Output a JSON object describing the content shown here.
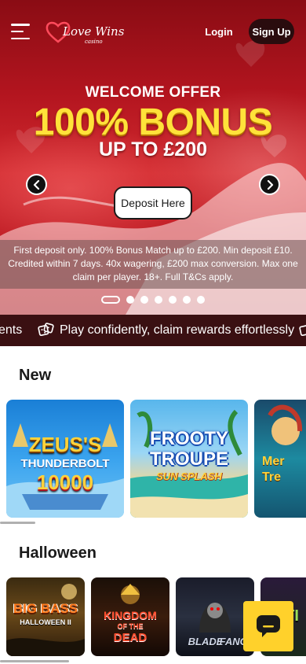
{
  "header": {
    "logo_text": "Love Wins",
    "logo_sub": "casino",
    "login_label": "Login",
    "signup_label": "Sign Up"
  },
  "hero": {
    "offer_small": "WELCOME OFFER",
    "offer_big": "100% BONUS",
    "offer_up": "UP TO £200",
    "deposit_label": "Deposit Here",
    "terms": "First deposit only. 100% Bonus Match up to £200. Min deposit £10. Credited within 7 days. 40x wagering, £200 max conversion. Max one claim per player. 18+. Full T&Cs apply.",
    "slides_total": 7,
    "active_slide": 1
  },
  "ticker": {
    "items": [
      "ents",
      "Play confidently, claim rewards effortlessly"
    ]
  },
  "sections": {
    "new": {
      "title": "New",
      "games": [
        {
          "line1": "ZEUS'S",
          "line2": "THUNDERBOLT",
          "line3": "10000"
        },
        {
          "line1": "FROOTY",
          "line2": "TROUPE",
          "line3": "SUN SPLASH"
        },
        {
          "line1": "Mer",
          "line2": "Tre",
          "line3": ""
        }
      ]
    },
    "halloween": {
      "title": "Halloween",
      "games": [
        {
          "line1": "BIG BASS",
          "line2": "HALLOWEEN II"
        },
        {
          "line1": "KINGDOM",
          "line2": "OF THE",
          "line3": "DEAD"
        },
        {
          "line1": "BLADE",
          "line2": "FANGS"
        },
        {
          "line1": "TI"
        }
      ]
    }
  },
  "colors": {
    "brand_red": "#b3151f",
    "ticker_bg": "#3a1012",
    "offer_yellow": "#ffe23a",
    "chat_yellow": "#ffd12b"
  },
  "icons": [
    "menu-icon",
    "heart-logo-icon",
    "chevron-left-icon",
    "chevron-right-icon",
    "dice-icon",
    "chat-icon"
  ]
}
